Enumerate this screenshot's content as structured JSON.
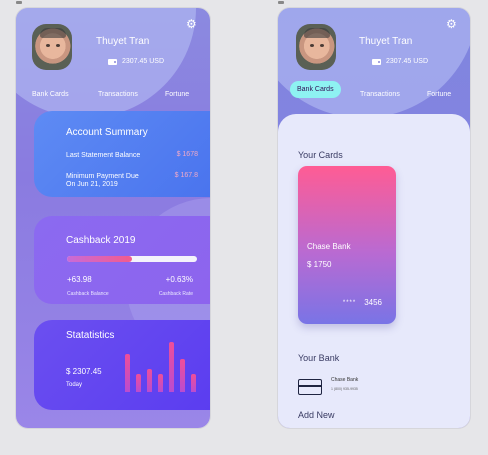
{
  "user": {
    "name": "Thuyet Tran",
    "balance": "2307.45 USD"
  },
  "nav": {
    "items": [
      "Bank Cards",
      "Transactions",
      "Fortune"
    ]
  },
  "summary": {
    "title": "Account Summary",
    "rows": [
      {
        "label": "Last Statement Balance",
        "value": "$ 1678"
      },
      {
        "label": "Minimum Payment Due",
        "sublabel": "On Jun 21, 2019",
        "value": "$ 167.8"
      }
    ]
  },
  "cashback": {
    "title": "Cashback 2019",
    "progress": 0.5,
    "balance_value": "+63.98",
    "balance_label": "Cashback Balance",
    "rate_value": "+0.63%",
    "rate_label": "Cashback Rate"
  },
  "statistics": {
    "title": "Statatistics",
    "amount": "$ 2307.45",
    "period": "Today",
    "bars": [
      0.75,
      0.35,
      0.45,
      0.35,
      1.0,
      0.65,
      0.35
    ]
  },
  "cards": {
    "title": "Your Cards",
    "bank_name": "Chase Bank",
    "amount": "$ 1750",
    "masked": "****",
    "last4": "3456"
  },
  "bank": {
    "title": "Your Bank",
    "name": "Chase Bank",
    "phone": "1 (800) 935-9935"
  },
  "add_new": "Add New",
  "colors": {
    "accent": "#8ef2f2",
    "card_start": "#ff5c94",
    "card_end": "#7974e6"
  }
}
